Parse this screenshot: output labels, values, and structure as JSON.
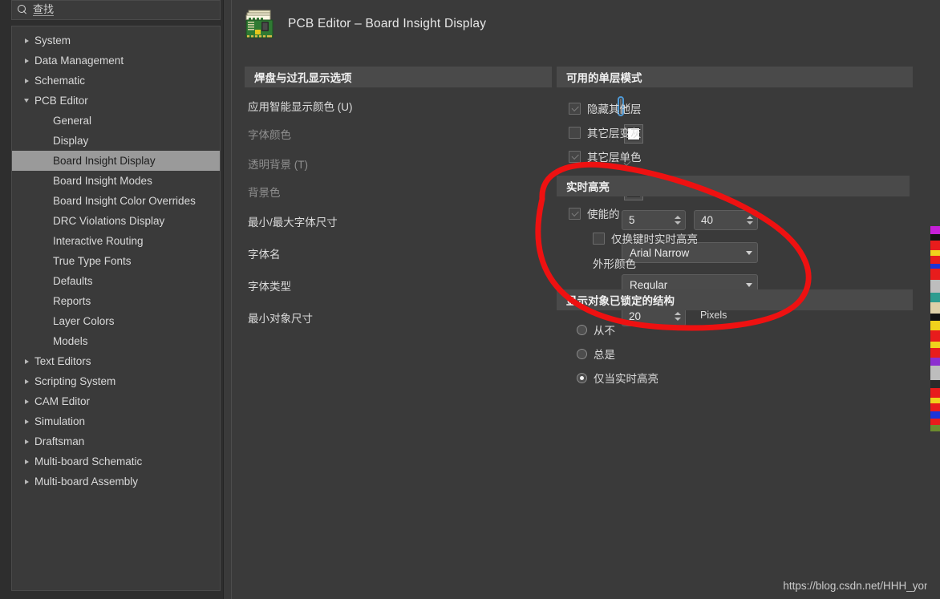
{
  "search": {
    "value": "查找",
    "icon": "search-icon"
  },
  "sidebar": {
    "items": [
      {
        "label": "System",
        "level": 0,
        "twisty": "collapsed",
        "selected": false
      },
      {
        "label": "Data Management",
        "level": 0,
        "twisty": "collapsed",
        "selected": false
      },
      {
        "label": "Schematic",
        "level": 0,
        "twisty": "collapsed",
        "selected": false
      },
      {
        "label": "PCB Editor",
        "level": 0,
        "twisty": "expanded",
        "selected": false
      },
      {
        "label": "General",
        "level": 1,
        "twisty": "none",
        "selected": false
      },
      {
        "label": "Display",
        "level": 1,
        "twisty": "none",
        "selected": false
      },
      {
        "label": "Board Insight Display",
        "level": 1,
        "twisty": "none",
        "selected": true
      },
      {
        "label": "Board Insight Modes",
        "level": 1,
        "twisty": "none",
        "selected": false
      },
      {
        "label": "Board Insight Color Overrides",
        "level": 1,
        "twisty": "none",
        "selected": false
      },
      {
        "label": "DRC Violations Display",
        "level": 1,
        "twisty": "none",
        "selected": false
      },
      {
        "label": "Interactive Routing",
        "level": 1,
        "twisty": "none",
        "selected": false
      },
      {
        "label": "True Type Fonts",
        "level": 1,
        "twisty": "none",
        "selected": false
      },
      {
        "label": "Defaults",
        "level": 1,
        "twisty": "none",
        "selected": false
      },
      {
        "label": "Reports",
        "level": 1,
        "twisty": "none",
        "selected": false
      },
      {
        "label": "Layer Colors",
        "level": 1,
        "twisty": "none",
        "selected": false
      },
      {
        "label": "Models",
        "level": 1,
        "twisty": "none",
        "selected": false
      },
      {
        "label": "Text Editors",
        "level": 0,
        "twisty": "collapsed",
        "selected": false
      },
      {
        "label": "Scripting System",
        "level": 0,
        "twisty": "collapsed",
        "selected": false
      },
      {
        "label": "CAM Editor",
        "level": 0,
        "twisty": "collapsed",
        "selected": false
      },
      {
        "label": "Simulation",
        "level": 0,
        "twisty": "collapsed",
        "selected": false
      },
      {
        "label": "Draftsman",
        "level": 0,
        "twisty": "collapsed",
        "selected": false
      },
      {
        "label": "Multi-board Schematic",
        "level": 0,
        "twisty": "collapsed",
        "selected": false
      },
      {
        "label": "Multi-board Assembly",
        "level": 0,
        "twisty": "collapsed",
        "selected": false
      }
    ]
  },
  "header": {
    "title": "PCB Editor – Board Insight Display",
    "icon": "pcb-board-icon"
  },
  "left_panel": {
    "section_title": "焊盘与过孔显示选项",
    "apply_smart_color": {
      "label": "应用智能显示颜色 (U)",
      "checked": true
    },
    "font_color": {
      "label": "字体颜色",
      "color": "#FFFFFF",
      "disabled": true
    },
    "transparent_bg": {
      "label": "透明背景 (T)",
      "checked": true,
      "disabled": true
    },
    "background_color": {
      "label": "背景色",
      "color": "#8E8E8E",
      "disabled": true
    },
    "font_size_range": {
      "label": "最小/最大字体尺寸",
      "min": "5",
      "max": "40"
    },
    "font_name": {
      "label": "字体名",
      "value": "Arial Narrow"
    },
    "font_style": {
      "label": "字体类型",
      "value": "Regular"
    },
    "min_object_size": {
      "label": "最小对象尺寸",
      "value": "20",
      "unit": "Pixels"
    }
  },
  "right_panel": {
    "single_layer_modes": {
      "section_title": "可用的单层模式",
      "options": [
        {
          "label": "隐藏其他层",
          "checked": true
        },
        {
          "label": "其它层变灰",
          "checked": false
        },
        {
          "label": "其它层单色",
          "checked": true
        }
      ]
    },
    "live_highlight": {
      "section_title": "实时高亮",
      "enabled": {
        "label": "使能的",
        "checked": true
      },
      "shift_only": {
        "label": "仅换键时实时高亮",
        "checked": false
      },
      "outline_color": {
        "label": "外形颜色",
        "color": "#E5DCBE"
      }
    },
    "locked_objects": {
      "section_title": "显示对象已锁定的结构",
      "options": [
        {
          "label": "从不",
          "selected": false
        },
        {
          "label": "总是",
          "selected": false
        },
        {
          "label": "仅当实时高亮",
          "selected": true
        }
      ]
    }
  },
  "annotation": {
    "type": "red-ellipse-ink",
    "color": "#EE1111"
  },
  "watermark": {
    "text": "https://blog.csdn.net/HHH_yong"
  }
}
